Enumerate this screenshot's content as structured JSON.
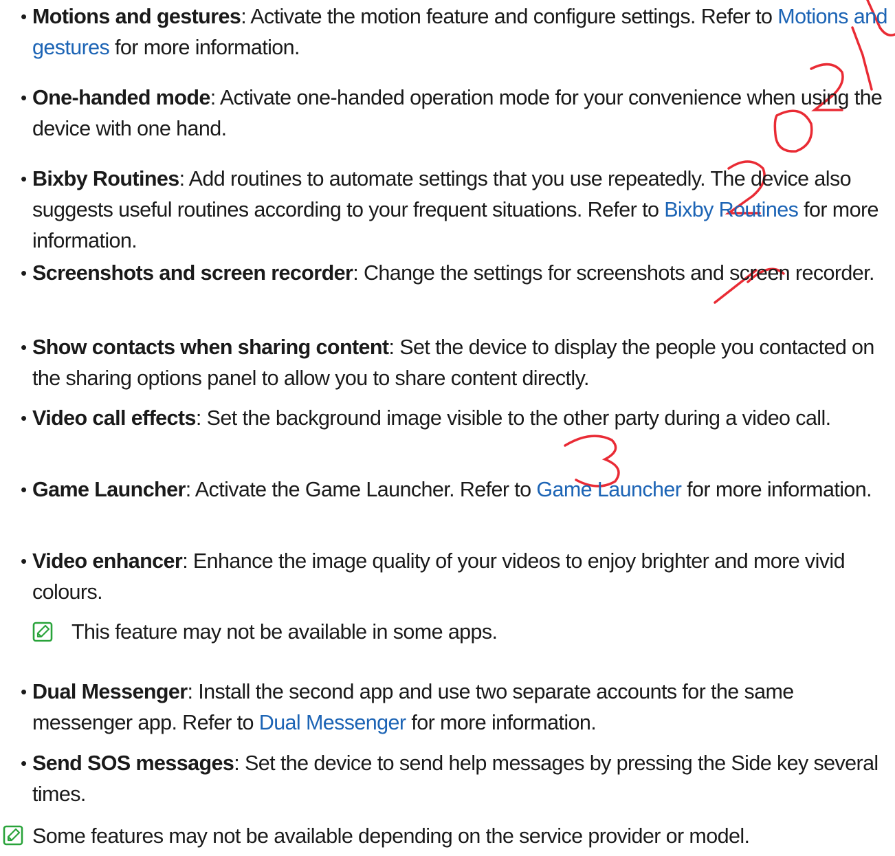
{
  "items": [
    {
      "term": "Motions and gestures",
      "text1": ": Activate the motion feature and configure settings. Refer to ",
      "link": "Motions and gestures",
      "text2": " for more information."
    },
    {
      "term": "One-handed mode",
      "text1": ": Activate one-handed operation mode for your convenience when using the device with one hand."
    },
    {
      "term": "Bixby Routines",
      "text1": ": Add routines to automate settings that you use repeatedly. The device also suggests useful routines according to your frequent situations. Refer to ",
      "link": "Bixby Routines",
      "text2": " for more information."
    },
    {
      "term": "Screenshots and screen recorder",
      "text1": ": Change the settings for screenshots and screen recorder."
    },
    {
      "term": "Show contacts when sharing content",
      "text1": ": Set the device to display the people you contacted on the sharing options panel to allow you to share content directly."
    },
    {
      "term": "Video call effects",
      "text1": ": Set the background image visible to the other party during a video call."
    },
    {
      "term": "Game Launcher",
      "text1": ": Activate the Game Launcher. Refer to ",
      "link": "Game Launcher",
      "text2": " for more information."
    },
    {
      "term": "Video enhancer",
      "text1": ": Enhance the image quality of your videos to enjoy brighter and more vivid colours."
    },
    {
      "term": "Dual Messenger",
      "text1": ": Install the second app and use two separate accounts for the same messenger app. Refer to ",
      "link": "Dual Messenger",
      "text2": " for more information."
    },
    {
      "term": "Send SOS messages",
      "text1": ": Set the device to send help messages by pressing the Side key several times."
    }
  ],
  "notes": {
    "video_enhancer_note": "This feature may not be available in some apps.",
    "footer_note": "Some features may not be available depending on the service provider or model."
  },
  "watermark": {
    "text": "2021-10-13",
    "color": "#e8202a"
  },
  "colors": {
    "link": "#1c64b5",
    "note_icon": "#29a33a",
    "text": "#1a1a1a"
  },
  "icons": {
    "bullet": "•",
    "note": "pencil-note-icon"
  }
}
